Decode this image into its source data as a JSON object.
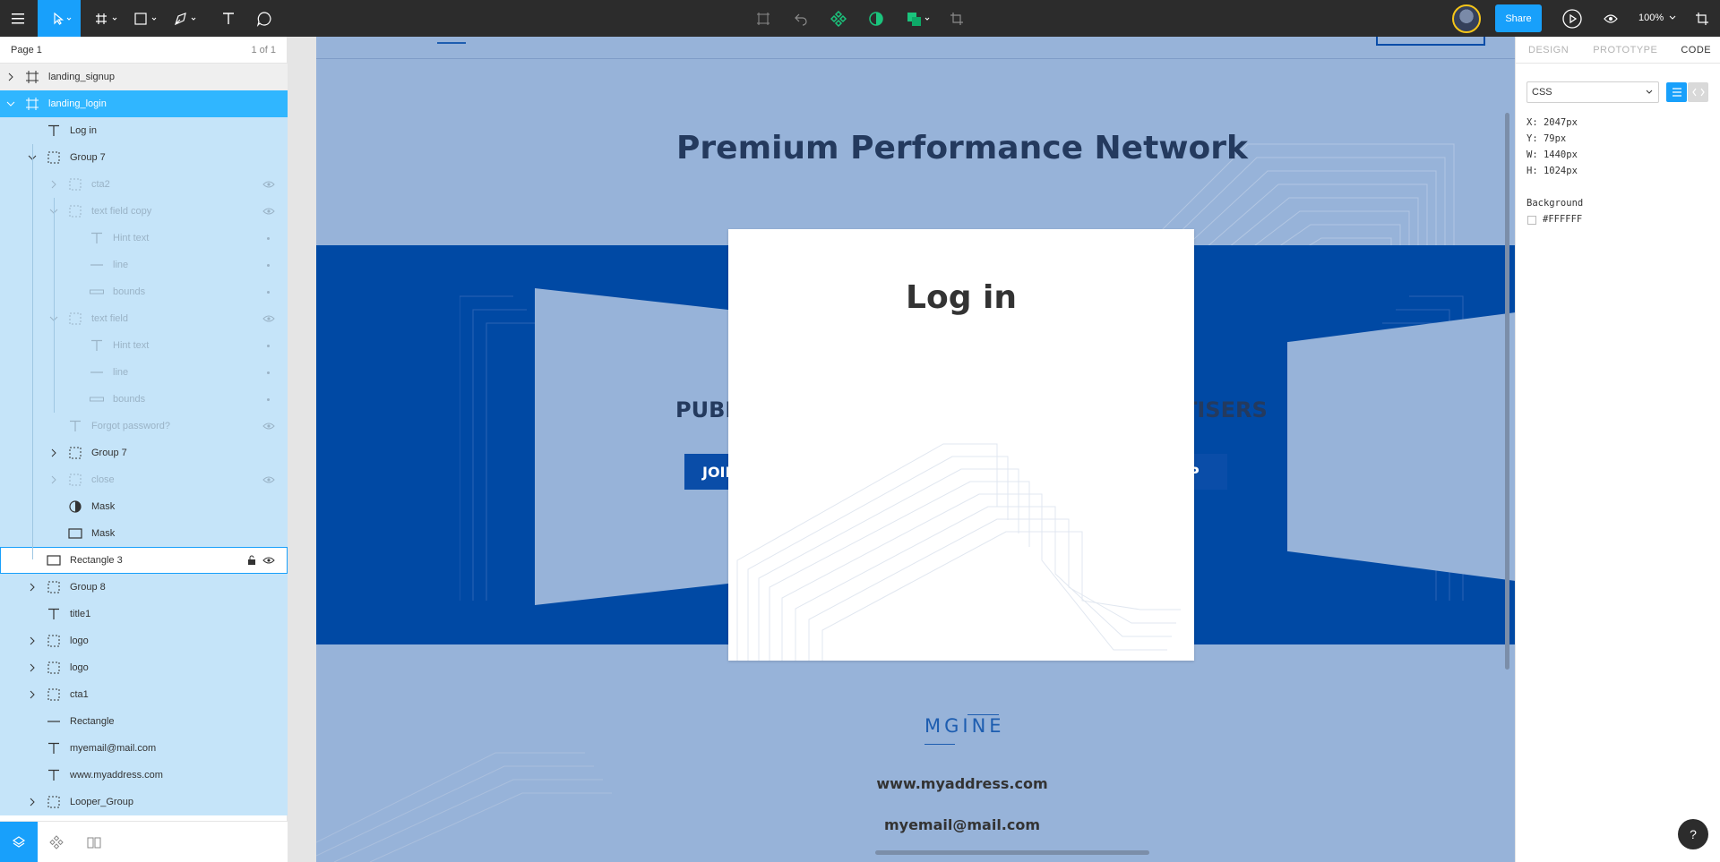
{
  "toolbar": {
    "share_label": "Share",
    "zoom_label": "100%",
    "icons": [
      "menu-icon",
      "move-tool-icon",
      "frame-tool-icon",
      "shape-tool-icon",
      "pen-tool-icon",
      "text-tool-icon",
      "comment-tool-icon",
      "component-icon",
      "undo-icon",
      "create-component-icon",
      "mask-icon",
      "boolean-icon",
      "crop-icon",
      "present-icon",
      "view-icon"
    ]
  },
  "layers": {
    "page_name": "Page 1",
    "page_count": "1 of 1",
    "items": [
      {
        "label": "landing_signup"
      },
      {
        "label": "landing_login"
      },
      {
        "label": "Log in"
      },
      {
        "label": "Group 7"
      },
      {
        "label": "cta2"
      },
      {
        "label": "text field copy"
      },
      {
        "label": "Hint text"
      },
      {
        "label": "line"
      },
      {
        "label": "bounds"
      },
      {
        "label": "text field"
      },
      {
        "label": "Hint text"
      },
      {
        "label": "line"
      },
      {
        "label": "bounds"
      },
      {
        "label": "Forgot password?"
      },
      {
        "label": "Group 7"
      },
      {
        "label": "close"
      },
      {
        "label": "Mask"
      },
      {
        "label": "Mask"
      },
      {
        "label": "Rectangle 3"
      },
      {
        "label": "Group 8"
      },
      {
        "label": "title1"
      },
      {
        "label": "logo"
      },
      {
        "label": "logo"
      },
      {
        "label": "cta1"
      },
      {
        "label": "Rectangle"
      },
      {
        "label": "myemail@mail.com"
      },
      {
        "label": "www.myaddress.com"
      },
      {
        "label": "Looper_Group"
      }
    ]
  },
  "canvas": {
    "hero_title": "Premium Performance Network",
    "sub_left": "PUBL",
    "sub_right": "TISERS",
    "btn_left": "JOIN",
    "btn_right": "UP",
    "modal_title": "Log in",
    "logo_text": "MGINE",
    "address": "www.myaddress.com",
    "email": "myemail@mail.com",
    "colors": {
      "canvas_bg": "#97b3d9",
      "hero_band": "#0049a4",
      "heading": "#243a5e"
    }
  },
  "props": {
    "tabs": [
      "DESIGN",
      "PROTOTYPE",
      "CODE"
    ],
    "active_tab": "CODE",
    "language": "CSS",
    "x": "X: 2047px",
    "y": "Y: 79px",
    "w": "W: 1440px",
    "h": "H: 1024px",
    "background_label": "Background",
    "background_value": "#FFFFFF"
  },
  "help_label": "?"
}
